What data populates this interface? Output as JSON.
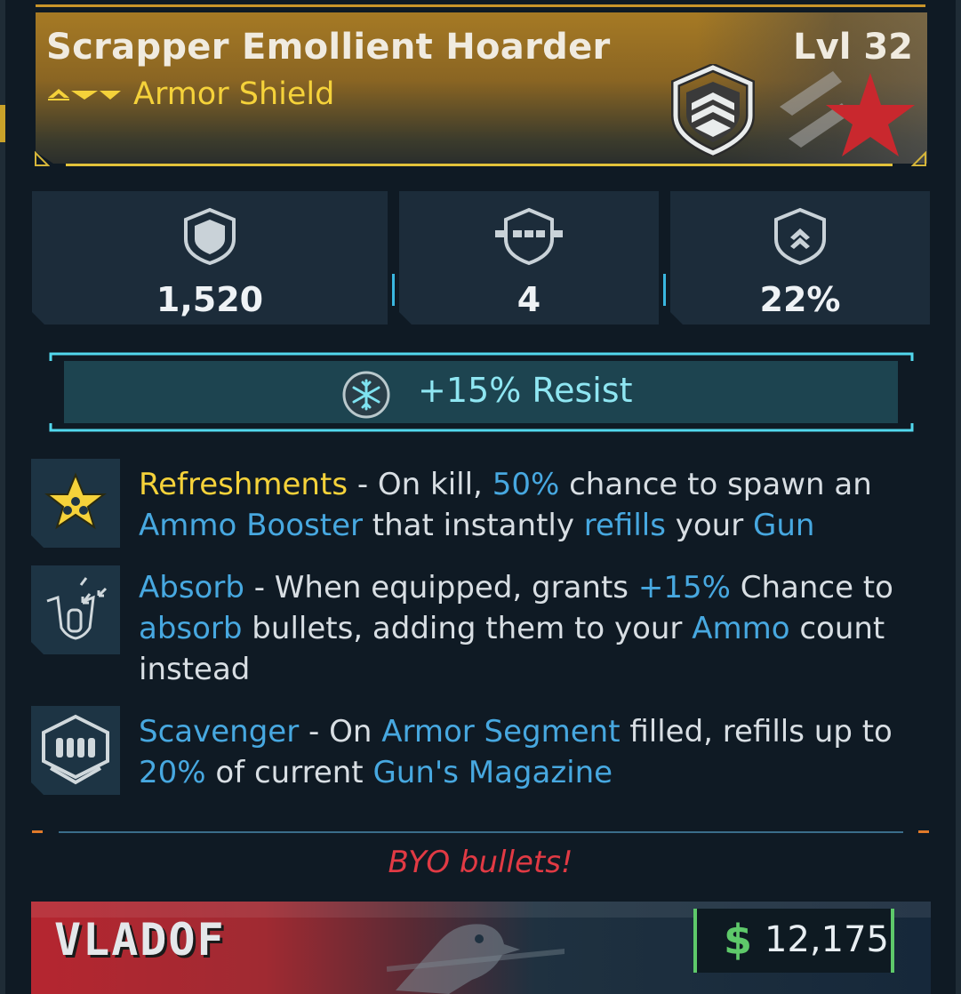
{
  "item": {
    "name": "Scrapper Emollient Hoarder",
    "level": "Lvl 32",
    "type": "Armor Shield",
    "rarity_icon": "rarity-chevrons-icon",
    "badge_icon": "shield-chevrons-icon",
    "manufacturer_emblem": "red-star-emblem-icon"
  },
  "stats": [
    {
      "icon": "shield-capacity-icon",
      "value": "1,520"
    },
    {
      "icon": "armor-segments-icon",
      "value": "4"
    },
    {
      "icon": "recharge-chevron-icon",
      "value": "22%"
    }
  ],
  "element": {
    "icon": "cryo-snowflake-icon",
    "text": "+15% Resist"
  },
  "perks": [
    {
      "icon": "refreshments-star-icon",
      "name": "Refreshments",
      "t1": " - On kill, ",
      "k1": "50%",
      "t2": " chance to spawn an ",
      "k2": "Ammo Booster",
      "t3": " that instantly ",
      "k3": "refills",
      "t4": " your ",
      "k4": "Gun"
    },
    {
      "icon": "absorb-bullet-icon",
      "name": "Absorb",
      "t1": " - When equipped, grants ",
      "k1": "+15%",
      "t2": " Chance to ",
      "k2": "absorb",
      "t3": " bullets, adding them to your ",
      "k3": "Ammo",
      "t4": " count instead"
    },
    {
      "icon": "scavenger-ammo-icon",
      "name": "Scavenger",
      "t1": " - On ",
      "k1": "Armor Segment",
      "t2": " filled, refills up to ",
      "k2": "20%",
      "t3": " of current ",
      "k3": "Gun's Magazine"
    }
  ],
  "flavor_text": "BYO bullets!",
  "manufacturer": "VLADOF",
  "price": {
    "currency_symbol": "$",
    "value": "12,175"
  },
  "colors": {
    "header_gold": "#a67a24",
    "type_yellow": "#f5d23a",
    "keyword_blue": "#47a8e0",
    "cryo_cyan": "#8fe6f2",
    "flavor_red": "#e13a44",
    "money_green": "#5ec96a",
    "panel_bg": "#0f1a24"
  }
}
